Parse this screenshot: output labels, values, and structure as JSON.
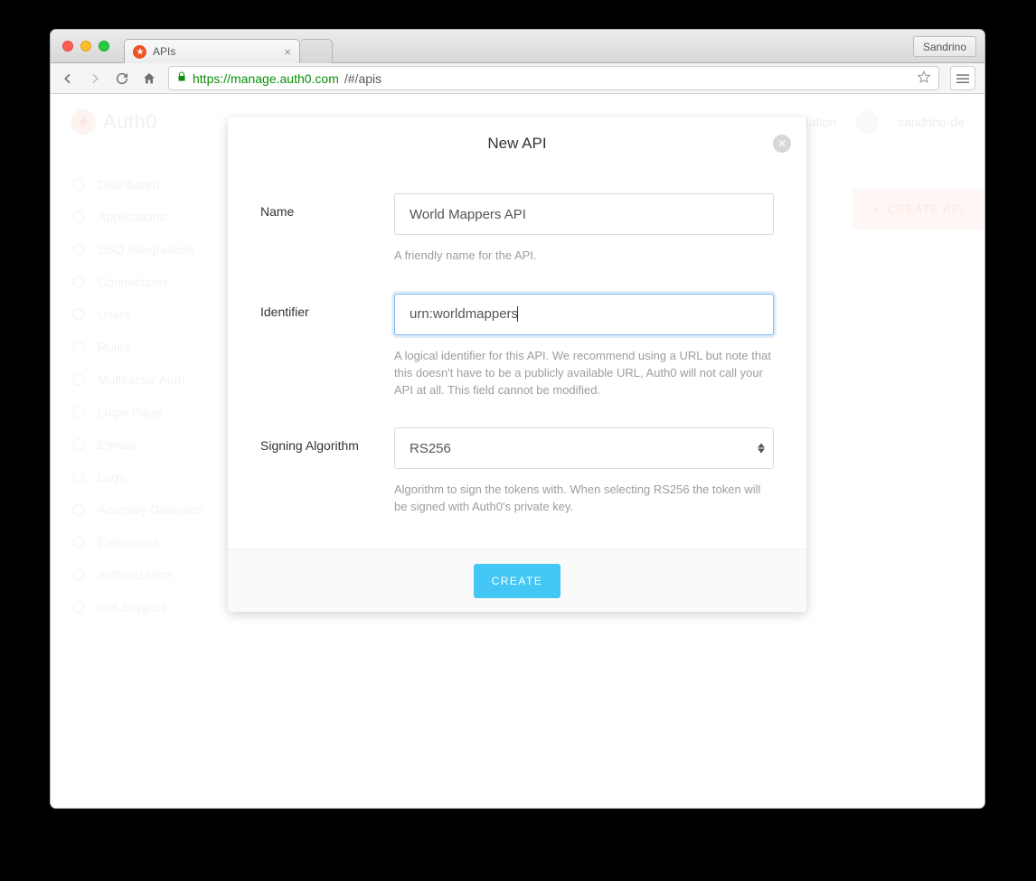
{
  "browser": {
    "profile_name": "Sandrino",
    "tab_title": "APIs",
    "url_host": "https://manage.auth0.com",
    "url_path": "/#/apis"
  },
  "app": {
    "brand": "Auth0",
    "header_links": {
      "docs": "documentation",
      "user": "sandrino-de"
    },
    "create_api_button": "CREATE API",
    "sidebar": [
      "Dashboard",
      "Applications",
      "SSO Integrations",
      "Connections",
      "Users",
      "Rules",
      "Multifactor Auth",
      "Login Page",
      "Emails",
      "Logs",
      "Anomaly Detection",
      "Extensions",
      "Authorization",
      "Get Support"
    ]
  },
  "modal": {
    "title": "New API",
    "name": {
      "label": "Name",
      "value": "World Mappers API",
      "help": "A friendly name for the API."
    },
    "identifier": {
      "label": "Identifier",
      "value": "urn:worldmappers",
      "help": "A logical identifier for this API. We recommend using a URL but note that this doesn't have to be a publicly available URL, Auth0 will not call your API at all. This field cannot be modified."
    },
    "algo": {
      "label": "Signing Algorithm",
      "value": "RS256",
      "help": "Algorithm to sign the tokens with. When selecting RS256 the token will be signed with Auth0's private key."
    },
    "create_button": "CREATE"
  }
}
